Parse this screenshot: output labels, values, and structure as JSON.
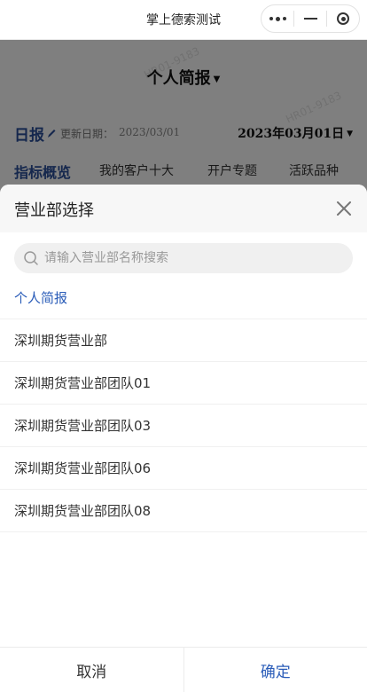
{
  "navbar": {
    "title": "掌上德索测试",
    "capsule": {
      "menu_icon": "more-dots-icon",
      "minimize_icon": "minimize-icon",
      "close_icon": "target-close-icon"
    }
  },
  "page": {
    "title": "个人简报",
    "watermarks": [
      "HR01-9183",
      "HR01-9183"
    ],
    "report_type": "日报",
    "update_label": "更新日期：",
    "update_date": "2023/03/01",
    "selected_date": "2023年03月01日",
    "tabs": [
      {
        "label": "指标概览",
        "active": true
      },
      {
        "label": "我的客户十大",
        "active": false
      },
      {
        "label": "开户专题",
        "active": false
      },
      {
        "label": "活跃品种",
        "active": false
      }
    ]
  },
  "sheet": {
    "title": "营业部选择",
    "search": {
      "placeholder": "请输入营业部名称搜索",
      "value": ""
    },
    "options": [
      {
        "label": "个人简报",
        "selected": true
      },
      {
        "label": "深圳期货营业部",
        "selected": false
      },
      {
        "label": "深圳期货营业部团队01",
        "selected": false
      },
      {
        "label": "深圳期货营业部团队03",
        "selected": false
      },
      {
        "label": "深圳期货营业部团队06",
        "selected": false
      },
      {
        "label": "深圳期货营业部团队08",
        "selected": false
      }
    ],
    "cancel_label": "取消",
    "confirm_label": "确定"
  },
  "colors": {
    "accent": "#2a5cb8",
    "report_blue": "#2a4f9a",
    "overlay": "rgba(0,0,0,0.5)"
  }
}
